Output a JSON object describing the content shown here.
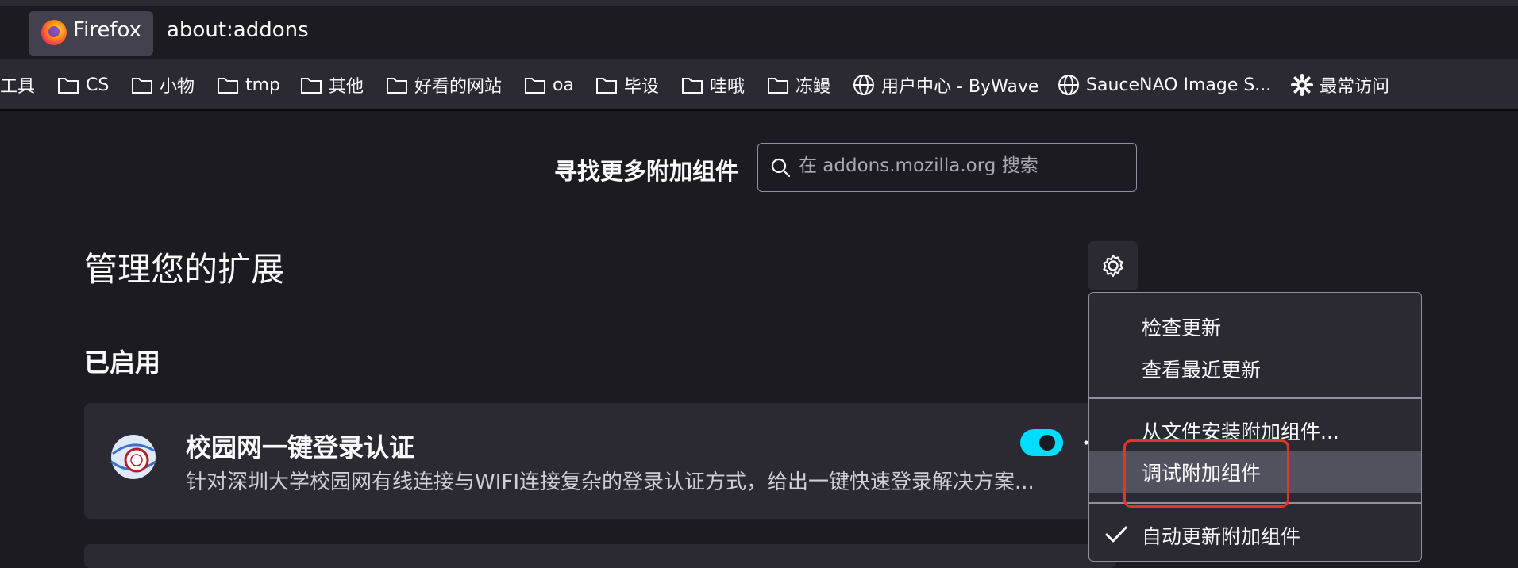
{
  "browser": {
    "identity_label": "Firefox",
    "url": "about:addons"
  },
  "bookmarks": [
    {
      "label": "工具",
      "icon": "none"
    },
    {
      "label": "CS",
      "icon": "folder-icon"
    },
    {
      "label": "小物",
      "icon": "folder-icon"
    },
    {
      "label": "tmp",
      "icon": "folder-icon"
    },
    {
      "label": "其他",
      "icon": "folder-icon"
    },
    {
      "label": "好看的网站",
      "icon": "folder-icon"
    },
    {
      "label": "oa",
      "icon": "folder-icon"
    },
    {
      "label": "毕设",
      "icon": "folder-icon"
    },
    {
      "label": "哇哦",
      "icon": "folder-icon"
    },
    {
      "label": "冻鳗",
      "icon": "folder-icon"
    },
    {
      "label": "用户中心 - ByWave",
      "icon": "globe-icon"
    },
    {
      "label": "SauceNAO Image S...",
      "icon": "globe-icon"
    },
    {
      "label": "最常访问",
      "icon": "gear-icon"
    }
  ],
  "search": {
    "label": "寻找更多附加组件",
    "placeholder": "在 addons.mozilla.org 搜索"
  },
  "page": {
    "title": "管理您的扩展",
    "section_enabled": "已启用"
  },
  "addon": {
    "name": "校园网一键登录认证",
    "description": "针对深圳大学校园网有线连接与WIFI连接复杂的登录认证方式，给出一键快速登录解决方案...",
    "enabled": true
  },
  "menu": {
    "items": [
      {
        "label": "检查更新"
      },
      {
        "label": "查看最近更新"
      },
      {
        "label": "从文件安装附加组件..."
      },
      {
        "label": "调试附加组件",
        "highlighted": true
      },
      {
        "label": "自动更新附加组件",
        "checked": true
      }
    ]
  },
  "colors": {
    "accent": "#00ddff",
    "highlight_border": "#e0372a",
    "background": "#1c1b22",
    "surface": "#2b2a33"
  }
}
